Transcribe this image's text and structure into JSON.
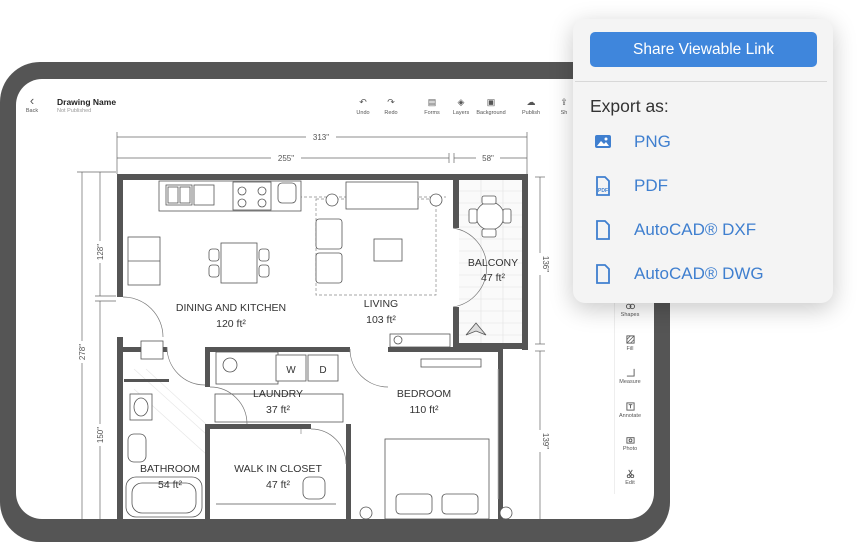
{
  "app": {
    "back_label": "Back",
    "drawing_name": "Drawing Name",
    "status": "Not Published"
  },
  "toolbar": {
    "undo": "Undo",
    "redo": "Redo",
    "forms": "Forms",
    "layers": "Layers",
    "background": "Background",
    "publish": "Publish",
    "share_partial": "Sh"
  },
  "right_tools": {
    "shapes": "Shapes",
    "fill": "Fill",
    "measure": "Measure",
    "annotate": "Annotate",
    "photo": "Photo",
    "edit": "Edit"
  },
  "plan": {
    "dims": {
      "top_total": "313\"",
      "top_left": "255\"",
      "top_right": "58\"",
      "left_upper": "128\"",
      "left_total": "278\"",
      "left_lower": "150\"",
      "right_upper": "136\"",
      "right_lower": "139\""
    },
    "rooms": {
      "dining_name": "DINING AND KITCHEN",
      "dining_area": "120 ft²",
      "living_name": "LIVING",
      "living_area": "103 ft²",
      "balcony_name": "BALCONY",
      "balcony_area": "47 ft²",
      "laundry_name": "LAUNDRY",
      "laundry_area": "37 ft²",
      "bedroom_name": "BEDROOM",
      "bedroom_area": "110 ft²",
      "bathroom_name": "BATHROOM",
      "bathroom_area": "54 ft²",
      "closet_name": "WALK IN CLOSET",
      "closet_area": "47 ft²"
    },
    "appliance_w": "W",
    "appliance_d": "D"
  },
  "popup": {
    "share_button": "Share Viewable Link",
    "export_label": "Export as:",
    "options": [
      "PNG",
      "PDF",
      "AutoCAD® DXF",
      "AutoCAD® DWG"
    ],
    "pdf_icon_text": "PDF"
  },
  "colors": {
    "accent": "#3f86dc",
    "link": "#3f7fcf",
    "frame": "#555555",
    "wall": "#555555"
  }
}
